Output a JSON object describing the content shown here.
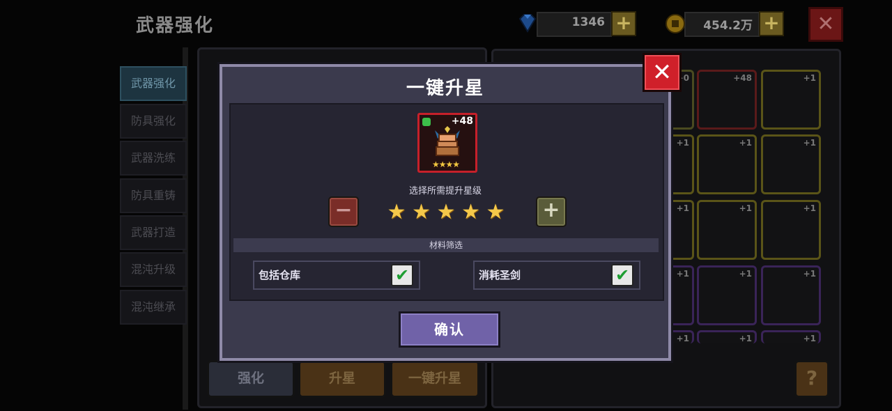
{
  "header": {
    "title": "武器强化",
    "gems": "1346",
    "gold": "454.2万",
    "plus": "+",
    "close": "✕"
  },
  "sidebar": {
    "items": [
      {
        "label": "武器强化"
      },
      {
        "label": "防具强化"
      },
      {
        "label": "武器洗练"
      },
      {
        "label": "防具重铸"
      },
      {
        "label": "武器打造"
      },
      {
        "label": "混沌升级"
      },
      {
        "label": "混沌继承"
      }
    ]
  },
  "bottom_tabs": {
    "enhance": "强化",
    "star_up": "升星",
    "one_key_star": "一键升星",
    "help": "?"
  },
  "grid": {
    "cells": [
      {
        "level": "+0"
      },
      {
        "level": "+48"
      },
      {
        "level": "+1"
      },
      {
        "level": "+1"
      },
      {
        "level": "+1"
      },
      {
        "level": "+1"
      },
      {
        "level": "+1"
      },
      {
        "level": "+1"
      },
      {
        "level": "+1"
      },
      {
        "level": "+1"
      },
      {
        "level": "+1"
      },
      {
        "level": "+1"
      },
      {
        "level": "+1"
      },
      {
        "level": "+1"
      },
      {
        "level": "+1"
      }
    ]
  },
  "dialog": {
    "title": "一键升星",
    "item_level": "+48",
    "item_stars": "★★★★",
    "choose_label": "选择所需提升星级",
    "minus": "−",
    "plus": "+",
    "selected_stars": 5,
    "filter_title": "材料筛选",
    "options": [
      {
        "label": "包括仓库",
        "checked": true
      },
      {
        "label": "消耗圣剑",
        "checked": true
      }
    ],
    "confirm": "确认",
    "close": "✕"
  },
  "colors": {
    "dialog_bg": "#3b3a4d",
    "confirm": "#7062a8",
    "close_red": "#d0202a",
    "star": "#f4c84a",
    "item_frame": "#c6202a"
  }
}
